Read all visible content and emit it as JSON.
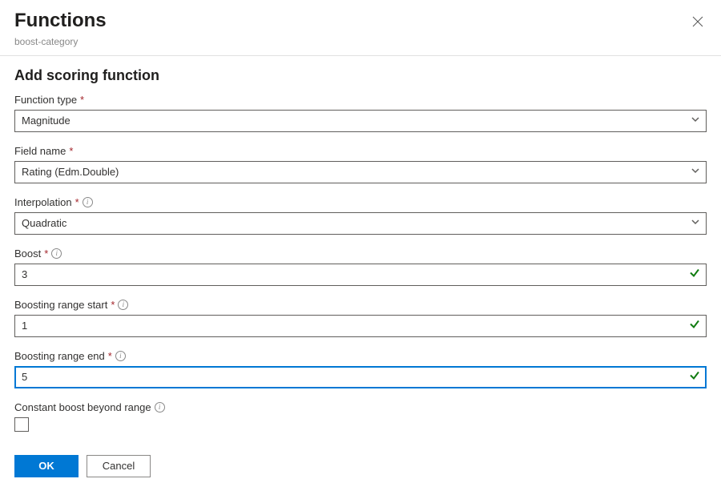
{
  "header": {
    "title": "Functions",
    "subtitle": "boost-category"
  },
  "section": {
    "title": "Add scoring function"
  },
  "fields": {
    "functionType": {
      "label": "Function type",
      "value": "Magnitude"
    },
    "fieldName": {
      "label": "Field name",
      "value": "Rating (Edm.Double)"
    },
    "interpolation": {
      "label": "Interpolation",
      "value": "Quadratic"
    },
    "boost": {
      "label": "Boost",
      "value": "3"
    },
    "rangeStart": {
      "label": "Boosting range start",
      "value": "1"
    },
    "rangeEnd": {
      "label": "Boosting range end",
      "value": "5"
    },
    "constantBoost": {
      "label": "Constant boost beyond range"
    }
  },
  "buttons": {
    "ok": "OK",
    "cancel": "Cancel"
  }
}
